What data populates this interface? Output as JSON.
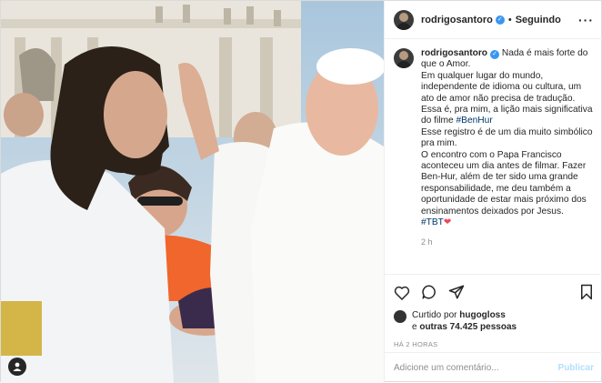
{
  "header": {
    "username": "rodrigosantoro",
    "separator": "•",
    "follow_status": "Seguindo",
    "more_icon": "ellipsis-icon"
  },
  "caption": {
    "username": "rodrigosantoro",
    "line1": "Nada é mais forte do que o Amor.",
    "line2": "Em qualquer lugar do mundo, independente de idioma ou cultura, um ato de amor não precisa de tradução. Essa é, pra mim, a lição mais significativa do filme",
    "hashtag_benhur": "#BenHur",
    "line3": "Esse registro é de um dia muito simbólico pra mim.",
    "line4": "O encontro com o Papa Francisco aconteceu um dia antes de filmar. Fazer Ben-Hur, além de ter sido uma grande responsabilidade, me deu também a oportunidade de estar mais próximo dos ensinamentos deixados por Jesus.",
    "hashtag_tbt": "#TBT",
    "heart": "❤",
    "time": "2 h"
  },
  "likes": {
    "prefix": "Curtido por",
    "user": "hugogloss",
    "conj": "e",
    "others": "outras 74.425 pessoas"
  },
  "posted_ago": "HÁ 2 HORAS",
  "comment": {
    "placeholder": "Adicione um comentário...",
    "publish": "Publicar"
  },
  "colors": {
    "verified": "#3897f0",
    "hashtag": "#00376b",
    "publish_disabled": "#b2dffc",
    "tbt_heart": "#ed4956"
  }
}
